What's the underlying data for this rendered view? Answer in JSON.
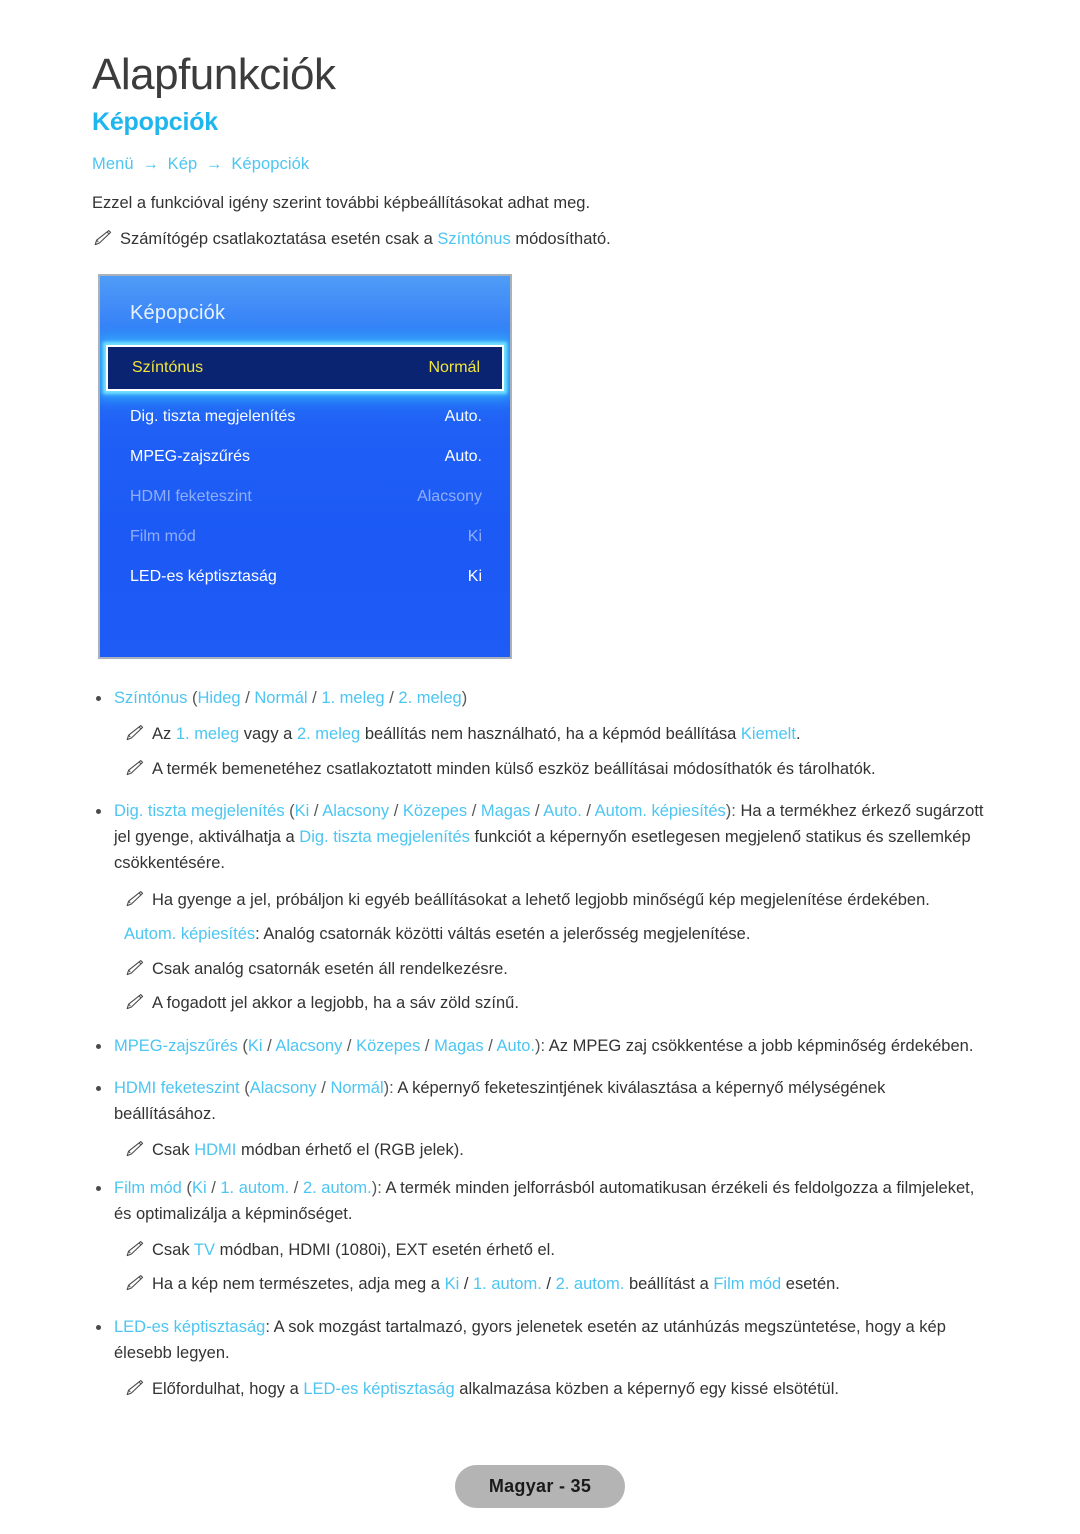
{
  "header": {
    "chapter": "Alapfunkciók",
    "section": "Képopciók",
    "breadcrumb": [
      "Menü",
      "Kép",
      "Képopciók"
    ],
    "arrow": "→",
    "intro": "Ezzel a funkcióval igény szerint további képbeállításokat adhat meg.",
    "intro_note": {
      "pre": "Számítógép csatlakoztatása esetén csak a ",
      "term": "Színtónus",
      "post": " módosítható."
    }
  },
  "osd": {
    "title": "Képopciók",
    "rows": [
      {
        "label": "Színtónus",
        "value": "Normál",
        "state": "selected"
      },
      {
        "label": "Dig. tiszta megjelenítés",
        "value": "Auto.",
        "state": "normal"
      },
      {
        "label": "MPEG-zajszűrés",
        "value": "Auto.",
        "state": "normal"
      },
      {
        "label": "HDMI feketeszint",
        "value": "Alacsony",
        "state": "disabled"
      },
      {
        "label": "Film mód",
        "value": "Ki",
        "state": "disabled"
      },
      {
        "label": "LED-es képtisztaság",
        "value": "Ki",
        "state": "normal"
      }
    ]
  },
  "content": {
    "b1": {
      "term": "Színtónus",
      "open": " (",
      "o1": "Hideg",
      "o2": "Normál",
      "o3": "1. meleg",
      "o4": "2. meleg",
      "close": ")"
    },
    "n1": {
      "t1": "Az ",
      "c1": "1. meleg",
      "t2": " vagy a ",
      "c2": "2. meleg",
      "t3": " beállítás nem használható, ha a képmód beállítása ",
      "c3": "Kiemelt",
      "t4": "."
    },
    "n2": "A termék bemenetéhez csatlakoztatott minden külső eszköz beállításai módosíthatók és tárolhatók.",
    "b2": {
      "term": "Dig. tiszta megjelenítés",
      "open": " (",
      "o1": "Ki",
      "o2": "Alacsony",
      "o3": "Közepes",
      "o4": "Magas",
      "o5": "Auto.",
      "o6": "Autom. képiesítés",
      "close": "): ",
      "t1": "Ha a termékhez érkező sugárzott jel gyenge, aktiválhatja a ",
      "c1": "Dig. tiszta megjelenítés",
      "t2": " funkciót a képernyőn esetlegesen megjelenő statikus és szellemkép csökkentésére."
    },
    "n3": "Ha gyenge a jel, próbáljon ki egyéb beállításokat a lehető legjobb minőségű kép megjelenítése érdekében.",
    "p_auto": {
      "term": "Autom. képiesítés",
      "rest": ": Analóg csatornák közötti váltás esetén a jelerősség megjelenítése."
    },
    "n4": "Csak analóg csatornák esetén áll rendelkezésre.",
    "n5": "A fogadott jel akkor a legjobb, ha a sáv zöld színű.",
    "b3": {
      "term": "MPEG-zajszűrés",
      "open": " (",
      "o1": "Ki",
      "o2": "Alacsony",
      "o3": "Közepes",
      "o4": "Magas",
      "o5": "Auto.",
      "close": "): ",
      "t1": "Az MPEG zaj csökkentése a jobb képminőség érdekében."
    },
    "b4": {
      "term": "HDMI feketeszint",
      "open": " (",
      "o1": "Alacsony",
      "o2": "Normál",
      "close": "): ",
      "t1": "A képernyő feketeszintjének kiválasztása a képernyő mélységének beállításához."
    },
    "n6": {
      "t1": "Csak ",
      "c1": "HDMI",
      "t2": " módban érhető el (RGB jelek)."
    },
    "b5": {
      "term": "Film mód",
      "open": " (",
      "o1": "Ki",
      "o2": "1. autom.",
      "o3": "2. autom.",
      "close": "): ",
      "t1": "A termék minden jelforrásból automatikusan érzékeli és feldolgozza a filmjeleket, és optimalizálja a képminőséget."
    },
    "n7": {
      "t1": "Csak ",
      "c1": "TV",
      "t2": " módban, HDMI (1080i), EXT esetén érhető el."
    },
    "n8": {
      "t1": "Ha a kép nem természetes, adja meg a ",
      "c1": "Ki",
      "t2": " / ",
      "c2": "1. autom.",
      "t3": " / ",
      "c3": "2. autom.",
      "t4": " beállítást a ",
      "c4": "Film mód",
      "t5": " esetén."
    },
    "b6": {
      "term": "LED-es képtisztaság",
      "t1": ": A sok mozgást tartalmazó, gyors jelenetek esetén az utánhúzás megszüntetése, hogy a kép élesebb legyen."
    },
    "n9": {
      "t1": "Előfordulhat, hogy a ",
      "c1": "LED-es képtisztaság",
      "t2": " alkalmazása közben a képernyő egy kissé elsötétül."
    }
  },
  "footer": {
    "page_label": "Magyar - 35"
  },
  "colors": {
    "accent_cyan": "#4cc5f2",
    "heading_cyan": "#1fb6ee",
    "osd_blue": "#1f5bf5",
    "osd_selected_bg": "#0b2472",
    "osd_selected_text": "#f2e53c"
  }
}
